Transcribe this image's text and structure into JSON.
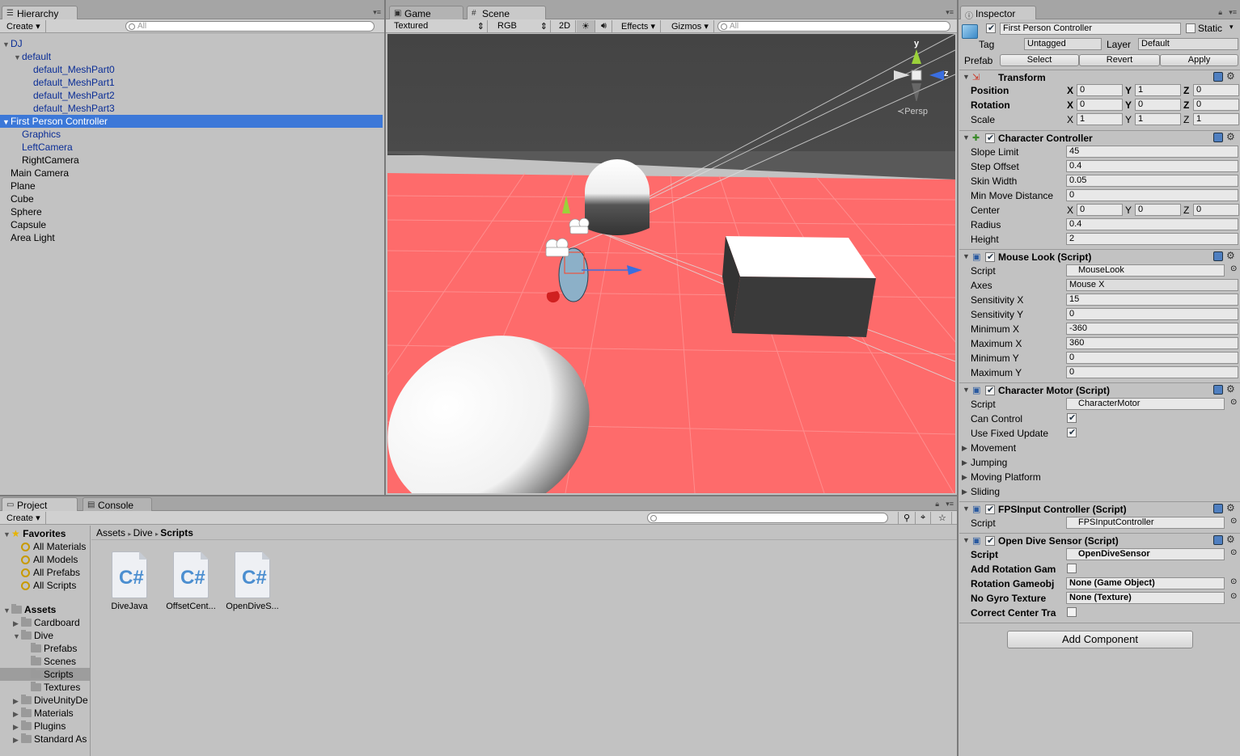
{
  "hierarchy": {
    "tab": "Hierarchy",
    "create": "Create",
    "search_placeholder": "All",
    "items": [
      {
        "label": "DJ",
        "depth": 0,
        "expanded": true,
        "prefab": true
      },
      {
        "label": "default",
        "depth": 1,
        "expanded": true,
        "prefab": true
      },
      {
        "label": "default_MeshPart0",
        "depth": 2,
        "prefab": true
      },
      {
        "label": "default_MeshPart1",
        "depth": 2,
        "prefab": true
      },
      {
        "label": "default_MeshPart2",
        "depth": 2,
        "prefab": true
      },
      {
        "label": "default_MeshPart3",
        "depth": 2,
        "prefab": true
      },
      {
        "label": "First Person Controller",
        "depth": 0,
        "expanded": true,
        "selected": true,
        "prefab": true
      },
      {
        "label": "Graphics",
        "depth": 1,
        "prefab": true
      },
      {
        "label": "LeftCamera",
        "depth": 1,
        "prefab": true
      },
      {
        "label": "RightCamera",
        "depth": 1
      },
      {
        "label": "Main Camera",
        "depth": 0
      },
      {
        "label": "Plane",
        "depth": 0
      },
      {
        "label": "Cube",
        "depth": 0
      },
      {
        "label": "Sphere",
        "depth": 0
      },
      {
        "label": "Capsule",
        "depth": 0
      },
      {
        "label": "Area Light",
        "depth": 0
      }
    ]
  },
  "scene": {
    "tab_game": "Game",
    "tab_scene": "Scene",
    "shading": "Textured",
    "channel": "RGB",
    "mode_2d": "2D",
    "effects": "Effects",
    "gizmos": "Gizmos",
    "search_placeholder": "All",
    "gizmo_y": "y",
    "gizmo_z": "z",
    "persp": "Persp"
  },
  "project": {
    "tab_project": "Project",
    "tab_console": "Console",
    "create": "Create",
    "favorites_label": "Favorites",
    "favorites": [
      "All Materials",
      "All Models",
      "All Prefabs",
      "All Scripts"
    ],
    "assets_label": "Assets",
    "folders": [
      {
        "label": "Cardboard",
        "depth": 1,
        "arrow": "right"
      },
      {
        "label": "Dive",
        "depth": 1,
        "arrow": "down"
      },
      {
        "label": "Prefabs",
        "depth": 2
      },
      {
        "label": "Scenes",
        "depth": 2
      },
      {
        "label": "Scripts",
        "depth": 2,
        "selected": true
      },
      {
        "label": "Textures",
        "depth": 2
      },
      {
        "label": "DiveUnityDe",
        "depth": 1,
        "arrow": "right"
      },
      {
        "label": "Materials",
        "depth": 1,
        "arrow": "right"
      },
      {
        "label": "Plugins",
        "depth": 1,
        "arrow": "right"
      },
      {
        "label": "Standard As",
        "depth": 1,
        "arrow": "right"
      }
    ],
    "breadcrumb": [
      "Assets",
      "Dive",
      "Scripts"
    ],
    "files": [
      "DiveJava",
      "OffsetCent...",
      "OpenDiveS..."
    ]
  },
  "inspector": {
    "tab": "Inspector",
    "object_name": "First Person Controller",
    "static_label": "Static",
    "tag_label": "Tag",
    "tag_value": "Untagged",
    "layer_label": "Layer",
    "layer_value": "Default",
    "prefab_label": "Prefab",
    "prefab_select": "Select",
    "prefab_revert": "Revert",
    "prefab_apply": "Apply",
    "transform": {
      "title": "Transform",
      "position": {
        "label": "Position",
        "x": "0",
        "y": "1",
        "z": "0"
      },
      "rotation": {
        "label": "Rotation",
        "x": "0",
        "y": "0",
        "z": "0"
      },
      "scale": {
        "label": "Scale",
        "x": "1",
        "y": "1",
        "z": "1"
      }
    },
    "xyz": {
      "x": "X",
      "y": "Y",
      "z": "Z"
    },
    "character_controller": {
      "title": "Character Controller",
      "rows": [
        {
          "label": "Slope Limit",
          "value": "45"
        },
        {
          "label": "Step Offset",
          "value": "0.4"
        },
        {
          "label": "Skin Width",
          "value": "0.05"
        },
        {
          "label": "Min Move Distance",
          "value": "0"
        }
      ],
      "center": {
        "label": "Center",
        "x": "0",
        "y": "0",
        "z": "0"
      },
      "rows2": [
        {
          "label": "Radius",
          "value": "0.4"
        },
        {
          "label": "Height",
          "value": "2"
        }
      ]
    },
    "mouse_look": {
      "title": "Mouse Look (Script)",
      "script_label": "Script",
      "script_value": "MouseLook",
      "axes_label": "Axes",
      "axes_value": "Mouse X",
      "rows": [
        {
          "label": "Sensitivity X",
          "value": "15"
        },
        {
          "label": "Sensitivity Y",
          "value": "0"
        },
        {
          "label": "Minimum X",
          "value": "-360"
        },
        {
          "label": "Maximum X",
          "value": "360"
        },
        {
          "label": "Minimum Y",
          "value": "0"
        },
        {
          "label": "Maximum Y",
          "value": "0"
        }
      ]
    },
    "character_motor": {
      "title": "Character Motor (Script)",
      "script_label": "Script",
      "script_value": "CharacterMotor",
      "can_control": "Can Control",
      "use_fixed_update": "Use Fixed Update",
      "foldouts": [
        "Movement",
        "Jumping",
        "Moving Platform",
        "Sliding"
      ]
    },
    "fps_input": {
      "title": "FPSInput Controller (Script)",
      "script_label": "Script",
      "script_value": "FPSInputController"
    },
    "open_dive": {
      "title": "Open Dive Sensor (Script)",
      "script_label": "Script",
      "script_value": "OpenDiveSensor",
      "add_rotation": "Add Rotation Gam",
      "rotation_gameobj": "Rotation Gameobj",
      "rotation_gameobj_value": "None (Game Object)",
      "no_gyro": "No Gyro Texture",
      "no_gyro_value": "None (Texture)",
      "correct_center": "Correct Center Tra"
    },
    "add_component": "Add Component"
  }
}
